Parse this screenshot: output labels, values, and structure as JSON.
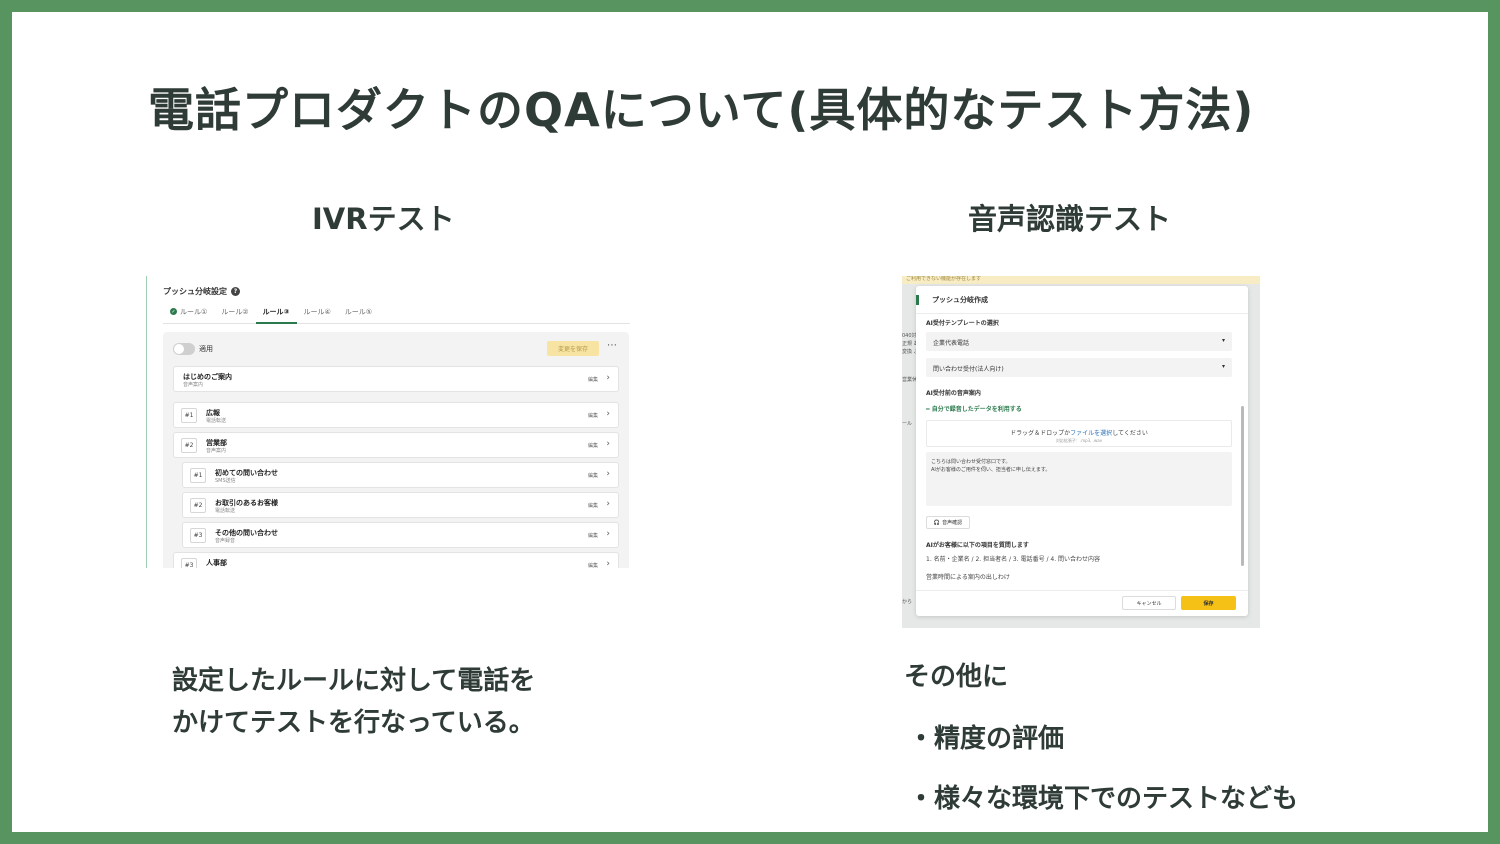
{
  "slide": {
    "title": "電話プロダクトのQAについて(具体的なテスト方法)",
    "ivr_heading": "IVRテスト",
    "voice_heading": "音声認識テスト",
    "ivr_description_line1": "設定したルールに対して電話を",
    "ivr_description_line2": "かけてテストを行なっている。",
    "other_heading": "その他に",
    "bullets": [
      "・精度の評価",
      "・様々な環境下でのテストなども"
    ]
  },
  "ivr": {
    "panel_title": "プッシュ分岐設定",
    "help_icon": "?",
    "tabs": [
      "ルール①",
      "ルール②",
      "ルール③",
      "ルール④",
      "ルール⑤"
    ],
    "active_tab": "ルール③",
    "check_mark": "✓",
    "apply_label": "適用",
    "save_label": "変更を保存",
    "more_label": "⋯",
    "edit_label": "編集",
    "chevron": "›",
    "intro": {
      "title": "はじめのご案内",
      "sub": "音声案内"
    },
    "rows": [
      {
        "num": "#1",
        "title": "広報",
        "sub": "電話転送"
      },
      {
        "num": "#2",
        "title": "営業部",
        "sub": "音声案内"
      },
      {
        "num": "#1",
        "title": "初めての問い合わせ",
        "sub": "SMS送信"
      },
      {
        "num": "#2",
        "title": "お取引のあるお客様",
        "sub": "電話転送"
      },
      {
        "num": "#3",
        "title": "その他の問い合わせ",
        "sub": "音声録音"
      },
      {
        "num": "#3",
        "title": "人事部",
        "sub": ""
      }
    ]
  },
  "voice": {
    "banner": "ご利用できない機能が存在します",
    "bg_texts": [
      "040対",
      "正規  あ",
      "変換  ふ",
      "営業休",
      "ール",
      "から"
    ],
    "modal_title": "プッシュ分岐作成",
    "template_label": "AI受付テンプレートの選択",
    "select1": "企業代表電話",
    "select2": "問い合わせ受付(法人向け)",
    "select_arrow": "▾",
    "voice_guide_label": "AI受付前の音声案内",
    "use_own_link": "━ 自分で録音したデータを利用する",
    "drop_prefix": "ドラッグ＆ドロップか",
    "drop_link": "ファイルを選択",
    "drop_suffix": "してください",
    "drop_formats": "対応拡張子：.mp3, .wav",
    "textarea_line1": "こちらは問い合わせ受付窓口です。",
    "textarea_line2": "AIがお客様のご用件を伺い、担当者に申し伝えます。",
    "sound_check_icon": "🎧",
    "sound_check": "音声確認",
    "questions_label": "AIがお客様に以下の項目を質問します",
    "questions": "1. 名前・企業名 / 2. 担当者名 / 3. 電話番号 / 4. 問い合わせ内容",
    "business_hours": "営業時間による案内の出しわけ",
    "cancel": "キャンセル",
    "save": "保存"
  }
}
